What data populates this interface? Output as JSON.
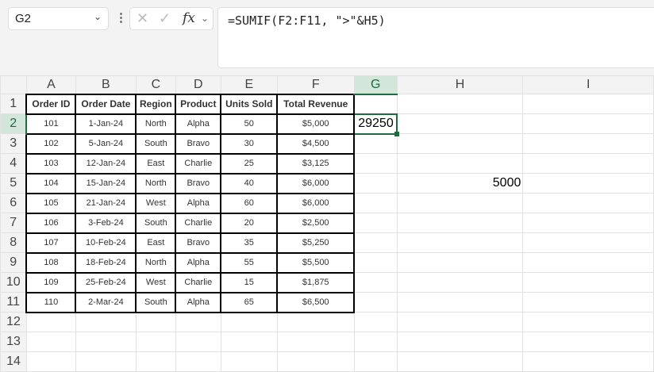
{
  "name_box": "G2",
  "formula": "=SUMIF(F2:F11, \">\"&H5)",
  "columns": [
    "A",
    "B",
    "C",
    "D",
    "E",
    "F",
    "G",
    "H",
    "I"
  ],
  "headers": [
    "Order ID",
    "Order Date",
    "Region",
    "Product",
    "Units Sold",
    "Total Revenue"
  ],
  "rows": [
    [
      "101",
      "1-Jan-24",
      "North",
      "Alpha",
      "50",
      "$5,000"
    ],
    [
      "102",
      "5-Jan-24",
      "South",
      "Bravo",
      "30",
      "$4,500"
    ],
    [
      "103",
      "12-Jan-24",
      "East",
      "Charlie",
      "25",
      "$3,125"
    ],
    [
      "104",
      "15-Jan-24",
      "North",
      "Bravo",
      "40",
      "$6,000"
    ],
    [
      "105",
      "21-Jan-24",
      "West",
      "Alpha",
      "60",
      "$6,000"
    ],
    [
      "106",
      "3-Feb-24",
      "South",
      "Charlie",
      "20",
      "$2,500"
    ],
    [
      "107",
      "10-Feb-24",
      "East",
      "Bravo",
      "35",
      "$5,250"
    ],
    [
      "108",
      "18-Feb-24",
      "North",
      "Alpha",
      "55",
      "$5,500"
    ],
    [
      "109",
      "25-Feb-24",
      "West",
      "Charlie",
      "15",
      "$1,875"
    ],
    [
      "110",
      "2-Mar-24",
      "South",
      "Alpha",
      "65",
      "$6,500"
    ]
  ],
  "g2_value": "29250",
  "h5_value": "5000",
  "row_numbers": [
    "1",
    "2",
    "3",
    "4",
    "5",
    "6",
    "7",
    "8",
    "9",
    "10",
    "11",
    "12",
    "13",
    "14"
  ]
}
